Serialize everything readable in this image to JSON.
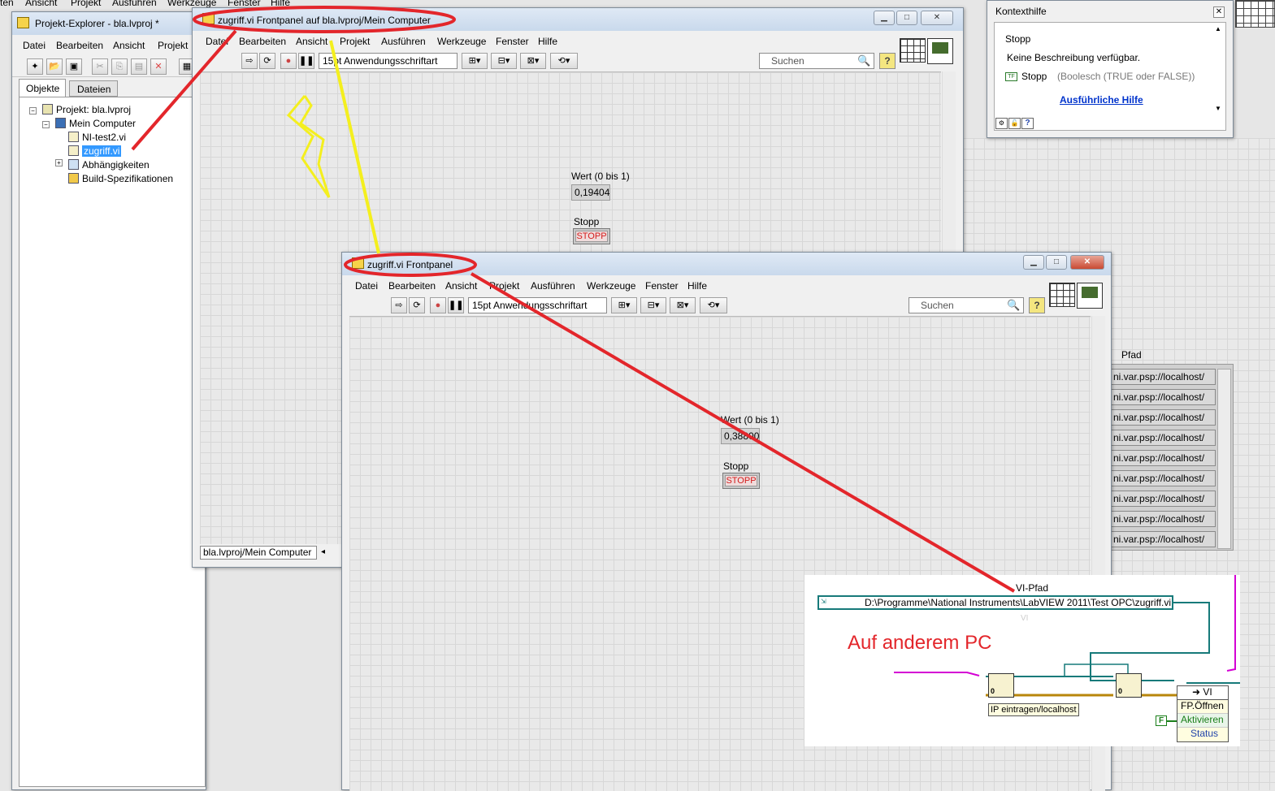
{
  "desktop_menu": [
    "ten",
    "Ansicht",
    "Projekt",
    "Ausführen",
    "Werkzeuge",
    "Fenster",
    "Hilfe"
  ],
  "explorer": {
    "title": "Projekt-Explorer - bla.lvproj *",
    "menu": [
      "Datei",
      "Bearbeiten",
      "Ansicht",
      "Projekt"
    ],
    "tabs": [
      "Objekte",
      "Dateien"
    ],
    "tree": [
      "Projekt: bla.lvproj",
      "Mein Computer",
      "NI-test2.vi",
      "zugriff.vi",
      "Abhängigkeiten",
      "Build-Spezifikationen"
    ]
  },
  "back_window": {
    "title": "zugriff.vi Frontpanel auf bla.lvproj/Mein Computer",
    "menu": [
      "Datei",
      "Bearbeiten",
      "Ansicht",
      "Projekt",
      "Ausführen",
      "Werkzeuge",
      "Fenster",
      "Hilfe"
    ],
    "font": "15pt Anwendungsschriftart",
    "search_placeholder": "Suchen",
    "wert_label": "Wert (0 bis 1)",
    "wert_value": "0,194045",
    "stopp_label": "Stopp",
    "stopp_button": "STOPP",
    "status_path": "bla.lvproj/Mein Computer"
  },
  "front_window": {
    "title": "zugriff.vi Frontpanel",
    "menu": [
      "Datei",
      "Bearbeiten",
      "Ansicht",
      "Projekt",
      "Ausführen",
      "Werkzeuge",
      "Fenster",
      "Hilfe"
    ],
    "font": "15pt Anwendungsschriftart",
    "search_placeholder": "Suchen",
    "wert_label": "Wert (0 bis 1)",
    "wert_value": "0,388003",
    "stopp_label": "Stopp",
    "stopp_button": "STOPP"
  },
  "context_help": {
    "title": "Kontexthilfe",
    "heading": "Stopp",
    "description": "Keine Beschreibung verfügbar.",
    "terminal_tag": "TF",
    "terminal_name": "Stopp",
    "terminal_type": "(Boolesch (TRUE oder FALSE))",
    "link": "Ausführliche Hilfe"
  },
  "path_list": {
    "label": "Pfad",
    "items": [
      "ni.var.psp://localhost/",
      "ni.var.psp://localhost/",
      "ni.var.psp://localhost/",
      "ni.var.psp://localhost/",
      "ni.var.psp://localhost/",
      "ni.var.psp://localhost/",
      "ni.var.psp://localhost/",
      "ni.var.psp://localhost/",
      "ni.var.psp://localhost/"
    ]
  },
  "block_diagram": {
    "vi_path_label": "VI-Pfad",
    "vi_path_value": "D:\\Programme\\National Instruments\\LabVIEW 2011\\Test OPC\\zugriff.vi",
    "ghost_label": "VI",
    "annotation": "Auf anderem PC",
    "ip_label": "IP eintragen/localhost",
    "node_vi": "VI",
    "node_props": [
      "FP.Öffnen",
      "Aktivieren",
      "Status"
    ],
    "false_const": "F",
    "zero": "0"
  },
  "colors": {
    "annotation_red": "#e3262b",
    "annotation_yellow": "#f4ef1e",
    "wire_teal": "#177a7a",
    "wire_pink": "#d400d4",
    "selection": "#3399ff"
  }
}
